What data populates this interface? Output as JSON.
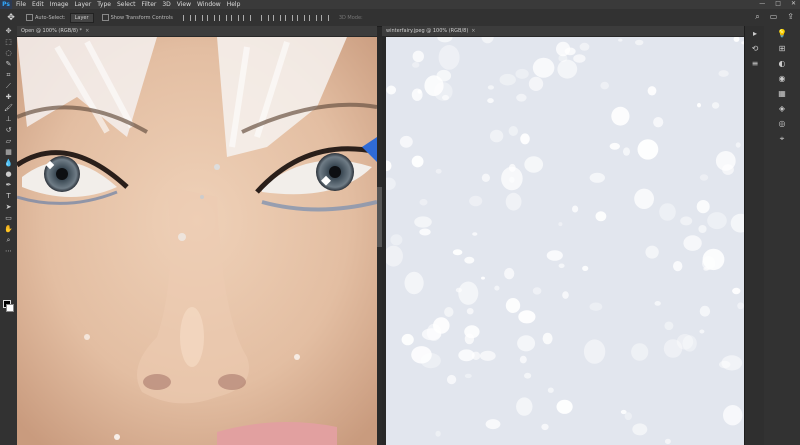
{
  "menu": {
    "logo": "Ps",
    "items": [
      "File",
      "Edit",
      "Image",
      "Layer",
      "Type",
      "Select",
      "Filter",
      "3D",
      "View",
      "Window",
      "Help"
    ],
    "window_controls": [
      "—",
      "□",
      "✕"
    ]
  },
  "options": {
    "auto_select_label": "Auto-Select:",
    "auto_select_value": "Layer",
    "transform_label": "Show Transform Controls",
    "mode_3d": "3D Mode:"
  },
  "doc1": {
    "tab": "Open @ 100% (RGB/8) *",
    "close": "×"
  },
  "doc2": {
    "tab": "winterfairy.jpeg @ 100% (RGB/8)",
    "close": "×"
  },
  "colors": {
    "ui_dark": "#282828",
    "panel": "#323232",
    "skin": "#e6c2a6",
    "snow_bg": "#e2e6ee"
  }
}
